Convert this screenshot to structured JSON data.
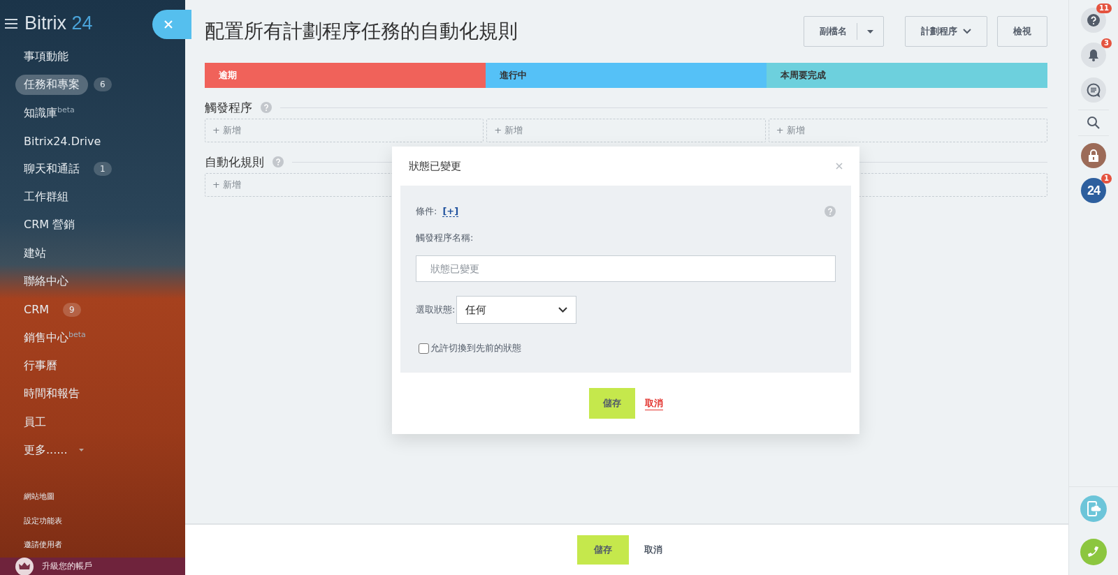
{
  "sidebar": {
    "logo_text": "Bitrix",
    "logo_number": "24",
    "items": [
      {
        "label": "事項動能",
        "selected": false
      },
      {
        "label": "任務和專案",
        "selected": true,
        "badge": "6"
      },
      {
        "label": "知識庫$^{beta}$",
        "selected": false
      },
      {
        "label": "Bitrix24.Drive",
        "selected": false
      },
      {
        "label": "聊天和通話",
        "selected": false,
        "badge": "1"
      },
      {
        "label": "工作群組",
        "selected": false
      },
      {
        "label": "CRM 營銷",
        "selected": false
      },
      {
        "label": "建站",
        "selected": false
      },
      {
        "label": "聯絡中心",
        "selected": false
      },
      {
        "label": "CRM",
        "selected": false,
        "badge": "9"
      },
      {
        "label": "銷售中心$^{beta}$",
        "selected": false
      },
      {
        "label": "行事曆",
        "selected": false
      },
      {
        "label": "時間和報告",
        "selected": false
      },
      {
        "label": "員工",
        "selected": false
      },
      {
        "label": "更多......",
        "selected": false,
        "has_menu": true
      }
    ],
    "links": [
      "網站地圖",
      "設定功能表",
      "邀請使用者"
    ],
    "upgrade": "升級您的帳戶"
  },
  "header": {
    "title": "配置所有計劃程序任務的自動化規則",
    "buttons": [
      {
        "label": "副檔名",
        "kind": "split"
      },
      {
        "label": "計劃程序",
        "kind": "dropdown"
      },
      {
        "label": "檢視",
        "kind": "plain"
      }
    ]
  },
  "stages": [
    {
      "label": "逾期",
      "color": "#f0625a"
    },
    {
      "label": "進行中",
      "color": "#55c1f7"
    },
    {
      "label": "本周要完成",
      "color": "#6dd0dd"
    }
  ],
  "triggers": {
    "title": "觸發程序",
    "columns": [
      "+ 新增",
      "+ 新增",
      "+ 新增"
    ]
  },
  "rules": {
    "title": "自動化規則",
    "columns": [
      "+ 新增"
    ]
  },
  "dialog": {
    "title": "狀態已變更",
    "condition_label": "條件:",
    "condition_link": "[+]",
    "name_label": "觸發程序名稱:",
    "name_placeholder": "狀態已變更",
    "status_label": "選取狀態:",
    "status_value": "任何",
    "allow_back": {
      "label": "允許切換到先前的狀態",
      "checked": false
    },
    "save": "儲存",
    "cancel": "取消"
  },
  "footer": {
    "save": "儲存",
    "cancel": "取消"
  },
  "right_bar": {
    "help_badge": "11",
    "bell_badge": "3",
    "app_label": "24",
    "app_badge": "1"
  }
}
